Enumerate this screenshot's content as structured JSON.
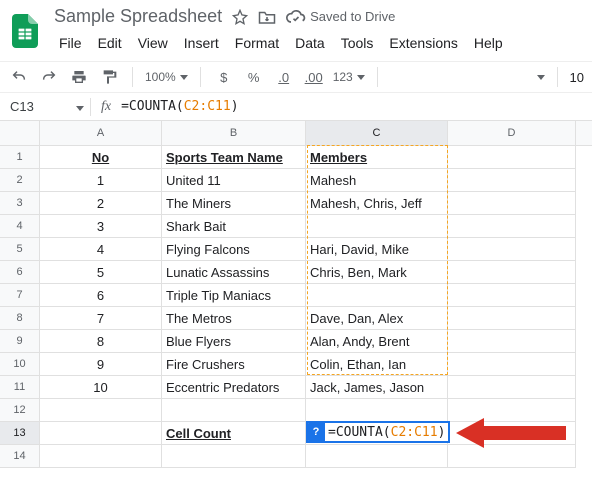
{
  "doc": {
    "title": "Sample Spreadsheet",
    "saved": "Saved to Drive"
  },
  "menu": {
    "file": "File",
    "edit": "Edit",
    "view": "View",
    "insert": "Insert",
    "format": "Format",
    "data": "Data",
    "tools": "Tools",
    "extensions": "Extensions",
    "help": "Help"
  },
  "toolbar": {
    "zoom": "100%",
    "dollar": "$",
    "percent": "%",
    "dec0": ".0",
    "dec00": ".00",
    "numfmt": "123",
    "fontsize": "10"
  },
  "fx": {
    "cellref": "C13",
    "fxlabel": "fx",
    "prefix": "=COUNTA",
    "open": "(",
    "range": "C2:C11",
    "close": ")"
  },
  "cols": {
    "A": "A",
    "B": "B",
    "C": "C",
    "D": "D"
  },
  "headers": {
    "no": "No",
    "team": "Sports Team Name",
    "members": "Members"
  },
  "rowsData": [
    {
      "n": "1",
      "no": "1",
      "team": "United 11",
      "members": "Mahesh"
    },
    {
      "n": "2",
      "no": "2",
      "team": "The Miners",
      "members": "Mahesh, Chris, Jeff"
    },
    {
      "n": "3",
      "no": "3",
      "team": "Shark Bait",
      "members": ""
    },
    {
      "n": "4",
      "no": "4",
      "team": "Flying Falcons",
      "members": "Hari, David, Mike"
    },
    {
      "n": "5",
      "no": "5",
      "team": "Lunatic Assassins",
      "members": "Chris, Ben, Mark"
    },
    {
      "n": "6",
      "no": "6",
      "team": "Triple Tip Maniacs",
      "members": ""
    },
    {
      "n": "7",
      "no": "7",
      "team": "The Metros",
      "members": "Dave, Dan, Alex"
    },
    {
      "n": "8",
      "no": "8",
      "team": "Blue Flyers",
      "members": "Alan, Andy, Brent"
    },
    {
      "n": "9",
      "no": "9",
      "team": "Fire Crushers",
      "members": "Colin, Ethan, Ian"
    },
    {
      "n": "10",
      "no": "10",
      "team": "Eccentric Predators",
      "members": "Jack, James, Jason"
    }
  ],
  "cellCountLabel": "Cell Count",
  "activeHint": "?",
  "rowNums": {
    "r12": "12",
    "r13": "13",
    "r14": "14"
  }
}
